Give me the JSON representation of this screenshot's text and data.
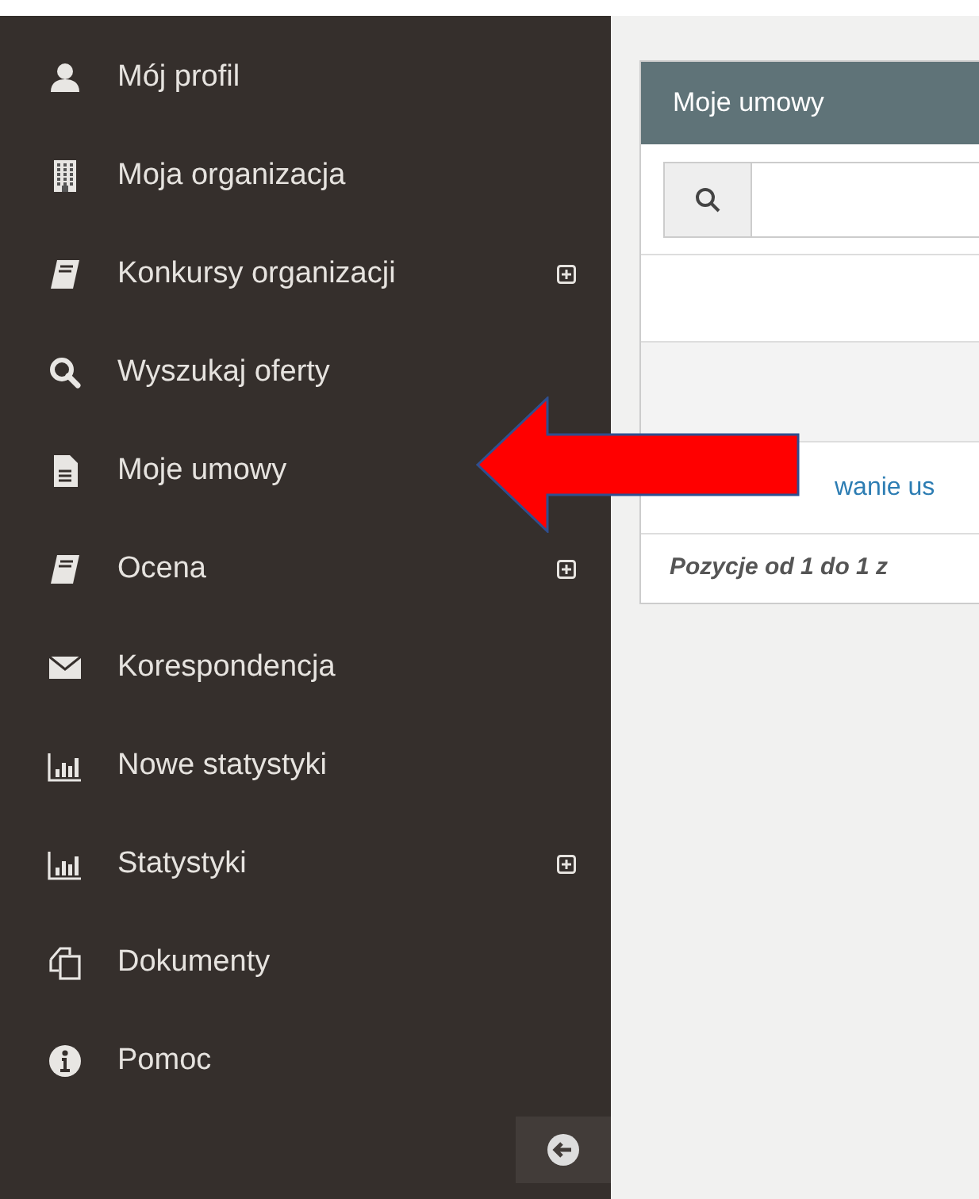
{
  "sidebar": {
    "items": [
      {
        "kind": "user",
        "label": "Mój profil",
        "expandable": false
      },
      {
        "kind": "building",
        "label": "Moja organizacja",
        "expandable": false
      },
      {
        "kind": "book",
        "label": "Konkursy organizacji",
        "expandable": true
      },
      {
        "kind": "search",
        "label": "Wyszukaj oferty",
        "expandable": false
      },
      {
        "kind": "file",
        "label": "Moje umowy",
        "expandable": false
      },
      {
        "kind": "book",
        "label": "Ocena",
        "expandable": true
      },
      {
        "kind": "mail",
        "label": "Korespondencja",
        "expandable": false
      },
      {
        "kind": "chart",
        "label": "Nowe statystyki",
        "expandable": false
      },
      {
        "kind": "chart",
        "label": "Statystyki",
        "expandable": true
      },
      {
        "kind": "copy",
        "label": "Dokumenty",
        "expandable": false
      },
      {
        "kind": "info",
        "label": "Pomoc",
        "expandable": false
      }
    ]
  },
  "panel": {
    "title": "Moje umowy",
    "link_text": "wanie us",
    "footer": "Pozycje od 1 do 1 z"
  }
}
